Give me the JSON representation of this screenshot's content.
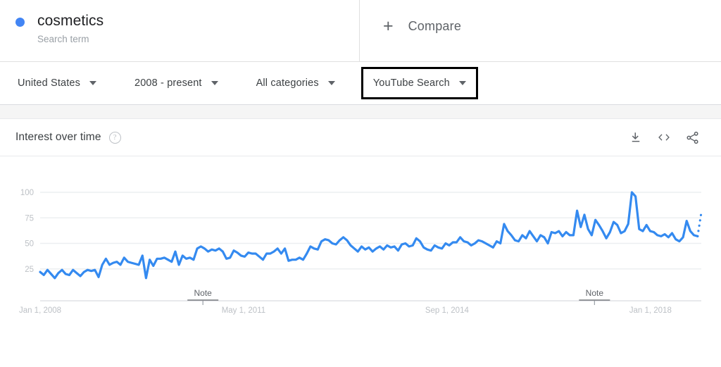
{
  "colors": {
    "series": "#4285F4",
    "line": "#348AF0",
    "grid": "#eceff1",
    "muted": "#bdc1c6",
    "highlight": "#000000"
  },
  "term_bar": {
    "term": {
      "name": "cosmetics",
      "subtitle": "Search term",
      "dot_color": "#4285F4"
    },
    "compare": {
      "icon": "plus-icon",
      "label": "Compare"
    }
  },
  "filters": [
    {
      "label": "United States",
      "icon": "chevron-down-icon",
      "selected": false
    },
    {
      "label": "2008 - present",
      "icon": "chevron-down-icon",
      "selected": false
    },
    {
      "label": "All categories",
      "icon": "chevron-down-icon",
      "selected": false
    },
    {
      "label": "YouTube Search",
      "icon": "chevron-down-icon",
      "selected": true
    }
  ],
  "card": {
    "title": "Interest over time",
    "help_icon": "help-circle-icon",
    "actions": [
      {
        "icon": "download-icon",
        "label": "Download"
      },
      {
        "icon": "embed-code-icon",
        "label": "<>"
      },
      {
        "icon": "share-icon",
        "label": "Share"
      }
    ]
  },
  "chart_data": {
    "type": "line",
    "title": "Interest over time",
    "xlabel": "",
    "ylabel": "",
    "ylim": [
      0,
      100
    ],
    "yticks": [
      25,
      50,
      75,
      100
    ],
    "grid": true,
    "legend": false,
    "xticks": [
      "Jan 1, 2008",
      "May 1, 2011",
      "Sep 1, 2014",
      "Jan 1, 2018"
    ],
    "xtick_positions": [
      0,
      0.3077,
      0.6154,
      0.9231
    ],
    "annotations": [
      {
        "label": "Note",
        "position": 0.2462
      },
      {
        "label": "Note",
        "position": 0.8385
      }
    ],
    "partial_last_point": true,
    "series": [
      {
        "name": "cosmetics",
        "color": "#4285F4",
        "values": [
          22,
          19,
          24,
          20,
          16,
          21,
          24,
          20,
          19,
          24,
          21,
          18,
          22,
          24,
          23,
          24,
          17,
          29,
          35,
          29,
          31,
          32,
          29,
          36,
          32,
          31,
          30,
          29,
          38,
          16,
          34,
          28,
          35,
          35,
          36,
          34,
          32,
          42,
          29,
          38,
          35,
          36,
          34,
          45,
          47,
          45,
          42,
          44,
          43,
          45,
          42,
          35,
          36,
          43,
          41,
          38,
          37,
          41,
          40,
          40,
          37,
          34,
          40,
          40,
          42,
          45,
          40,
          45,
          33,
          34,
          34,
          36,
          34,
          40,
          47,
          45,
          44,
          52,
          54,
          53,
          50,
          49,
          53,
          56,
          53,
          48,
          45,
          42,
          47,
          44,
          46,
          42,
          45,
          47,
          44,
          48,
          46,
          47,
          43,
          49,
          50,
          47,
          48,
          55,
          52,
          46,
          44,
          43,
          48,
          46,
          45,
          50,
          48,
          51,
          51,
          56,
          52,
          51,
          48,
          50,
          53,
          52,
          50,
          48,
          46,
          52,
          50,
          69,
          62,
          58,
          53,
          52,
          58,
          55,
          62,
          57,
          52,
          58,
          56,
          50,
          61,
          60,
          62,
          57,
          61,
          58,
          58,
          82,
          66,
          78,
          64,
          58,
          73,
          68,
          62,
          55,
          61,
          71,
          68,
          60,
          62,
          69,
          100,
          96,
          64,
          62,
          68,
          62,
          61,
          58,
          57,
          59,
          56,
          60,
          54,
          52,
          56,
          72,
          62,
          58,
          57,
          80
        ]
      }
    ]
  }
}
